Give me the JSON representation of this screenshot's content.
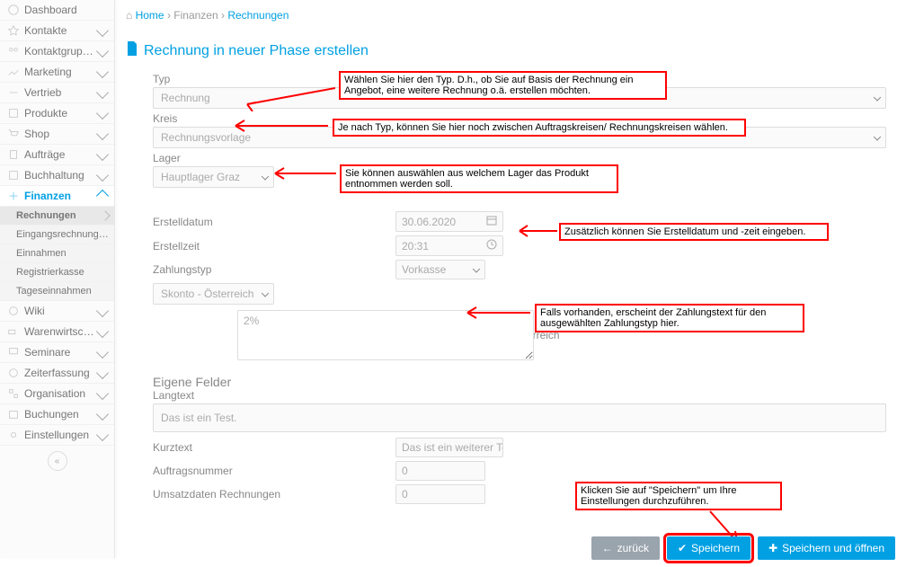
{
  "breadcrumb": {
    "home": "Home",
    "sec1": "Finanzen",
    "sec2": "Rechnungen"
  },
  "title": "Rechnung in neuer Phase erstellen",
  "sidebar": {
    "items": [
      "Dashboard",
      "Kontakte",
      "Kontaktgruppen",
      "Marketing",
      "Vertrieb",
      "Produkte",
      "Shop",
      "Aufträge",
      "Buchhaltung",
      "Finanzen",
      "Wiki",
      "Warenwirtschaft",
      "Seminare",
      "Zeiterfassung",
      "Organisation",
      "Buchungen",
      "Einstellungen"
    ],
    "sub": [
      "Rechnungen",
      "Eingangsrechnungen",
      "Einnahmen",
      "Registrierkasse",
      "Tageseinnahmen"
    ]
  },
  "fields": {
    "typ_label": "Typ",
    "typ_value": "Rechnung",
    "kreis_label": "Kreis",
    "kreis_value": "Rechnungsvorlage",
    "lager_label": "Lager",
    "lager_value": "Hauptlager Graz",
    "erstelldatum_label": "Erstelldatum",
    "erstelldatum_value": "30.06.2020",
    "erstellzeit_label": "Erstellzeit",
    "erstellzeit_value": "20:31",
    "zahlungstyp_label": "Zahlungstyp",
    "zahlungstyp_value": "Vorkasse",
    "skonto_select": "Skonto - Österreich",
    "skonto_label": "Skonto - Österreich",
    "skonto_text": "2%",
    "eigene_felder": "Eigene Felder",
    "langtext_label": "Langtext",
    "langtext_value": "Das ist ein Test.",
    "kurztext_label": "Kurztext",
    "kurztext_value": "Das ist ein weiterer Test",
    "auftragsnummer_label": "Auftragsnummer",
    "auftragsnummer_value": "0",
    "umsatzdaten_label": "Umsatzdaten Rechnungen",
    "umsatzdaten_value": "0"
  },
  "annotations": {
    "typ": "Wählen Sie hier den Typ. D.h., ob Sie auf Basis der Rechnung ein Angebot, eine weitere Rechnung o.ä. erstellen möchten.",
    "kreis": "Je nach Typ, können Sie hier noch zwischen Auftragskreisen/ Rechnungskreisen wählen.",
    "lager": "Sie können auswählen aus welchem Lager das Produkt entnommen werden soll.",
    "datum": "Zusätzlich können Sie Erstelldatum und -zeit eingeben.",
    "zahlungstext": "Falls vorhanden, erscheint der Zahlungstext für den ausgewählten Zahlungstyp hier.",
    "speichern": "Klicken Sie auf \"Speichern\" um Ihre Einstellungen durchzuführen."
  },
  "buttons": {
    "back": "zurück",
    "save": "Speichern",
    "save_open": "Speichern und öffnen"
  }
}
